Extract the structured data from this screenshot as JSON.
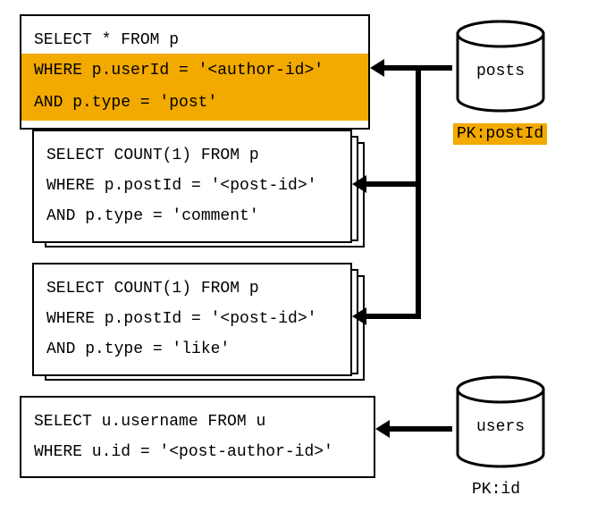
{
  "queries": {
    "q1": {
      "line1": "SELECT * FROM p",
      "line2": "WHERE p.userId = '<author-id>'",
      "line3": "AND p.type = 'post'"
    },
    "q2": {
      "line1": "SELECT COUNT(1) FROM p",
      "line2": "WHERE p.postId = '<post-id>'",
      "line3": "AND p.type = 'comment'"
    },
    "q3": {
      "line1": "SELECT COUNT(1) FROM p",
      "line2": "WHERE p.postId = '<post-id>'",
      "line3": "AND p.type = 'like'"
    },
    "q4": {
      "line1": "SELECT u.username FROM u",
      "line2": "WHERE u.id = '<post-author-id>'"
    }
  },
  "databases": {
    "posts": {
      "label": "posts",
      "pk": "PK:postId"
    },
    "users": {
      "label": "users",
      "pk": "PK:id"
    }
  }
}
